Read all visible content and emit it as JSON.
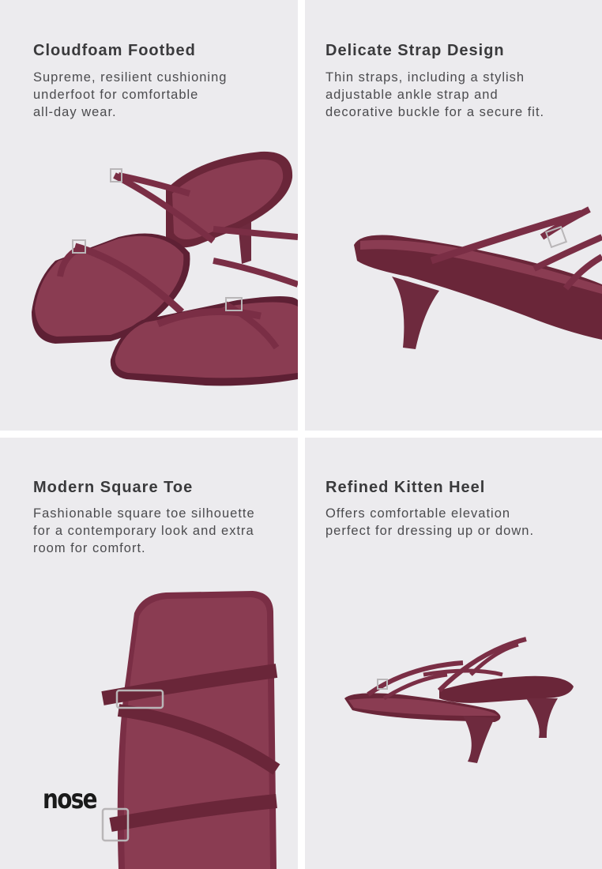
{
  "panels": [
    {
      "title": "Cloudfoam Footbed",
      "lines": [
        "Supreme, resilient cushioning",
        "underfoot for comfortable",
        "all-day wear."
      ],
      "image": "sandal-pair-front-view"
    },
    {
      "title": "Delicate Strap Design",
      "lines": [
        "Thin straps, including a stylish",
        "adjustable ankle strap and",
        "decorative buckle for a secure fit."
      ],
      "image": "sandal-side-heel-view"
    },
    {
      "title": "Modern Square Toe",
      "lines": [
        "Fashionable square toe silhouette",
        "for a contemporary look and extra",
        "room for comfort."
      ],
      "image": "sandal-top-toe-closeup"
    },
    {
      "title": "Refined Kitten Heel",
      "lines": [
        "Offers comfortable elevation",
        "perfect for dressing up or down."
      ],
      "image": "sandal-pair-side-view"
    }
  ],
  "brand": {
    "logo_text": "nose"
  },
  "colors": {
    "panel_bg": "#ecebee",
    "suede": "#7a2e45",
    "suede_dark": "#5e2034",
    "footbed": "#8a3c52",
    "heading": "#3a3a3c",
    "body_text": "#4b4b4e"
  }
}
